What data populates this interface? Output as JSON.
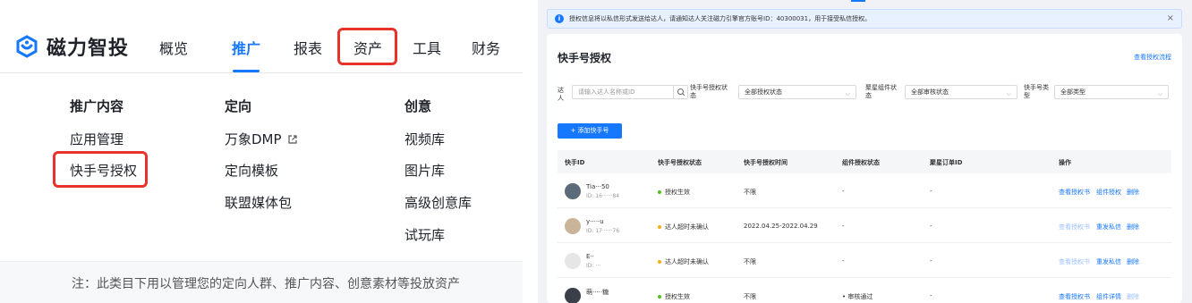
{
  "left": {
    "brand": "磁力智投",
    "nav": [
      "概览",
      "推广",
      "报表",
      "资产",
      "工具",
      "财务"
    ],
    "columns": [
      {
        "title": "推广内容",
        "items": [
          "应用管理",
          "快手号授权"
        ]
      },
      {
        "title": "定向",
        "items": [
          "万象DMP",
          "定向模板",
          "联盟媒体包"
        ]
      },
      {
        "title": "创意",
        "items": [
          "视频库",
          "图片库",
          "高级创意库",
          "试玩库"
        ]
      }
    ],
    "footer_note": "注：此类目下用以管理您的定向人群、推广内容、创意素材等投放资产"
  },
  "right": {
    "notice": "授权信息将以私信形式发送给达人，请通知达人关注磁力引擎官方账号ID：40300031，用于接受私信授权。",
    "close": "×",
    "title": "快手号授权",
    "view_flow": "查看授权流程",
    "filters": {
      "talent_label": "达人",
      "talent_placeholder": "请输入达人名称或ID",
      "auth_status_label": "快手号授权状态",
      "auth_status_value": "全部授权状态",
      "agg_label": "聚星组件状态",
      "agg_value": "全部审核状态",
      "type_label": "快手号类型",
      "type_value": "全部类型"
    },
    "add_button": "+ 添加快手号",
    "columns": [
      "快手ID",
      "快手号授权状态",
      "快手号授权时间",
      "组件授权状态",
      "聚星订单ID",
      "操作"
    ],
    "rows": [
      {
        "name": "Tia···50",
        "id": "ID: 16······84",
        "status": "授权生效",
        "status_color": "#52c41a",
        "time": "不限",
        "component": "-",
        "order": "-",
        "actions": [
          "查看授权书",
          "组件授权",
          "删除"
        ],
        "dim": [
          false,
          false,
          false
        ]
      },
      {
        "name": "y·····u",
        "id": "ID: 17······76",
        "status": "达人超时未确认",
        "status_color": "#faad14",
        "time": "2022.04.25-2022.04.29",
        "component": "-",
        "order": "-",
        "actions": [
          "查看授权书",
          "重发私信",
          "删除"
        ],
        "dim": [
          true,
          false,
          false
        ]
      },
      {
        "name": "E··",
        "id": "ID: ···",
        "status": "达人超时未确认",
        "status_color": "#faad14",
        "time": "不限",
        "component": "-",
        "order": "-",
        "actions": [
          "查看授权书",
          "重发私信",
          "删除"
        ],
        "dim": [
          true,
          false,
          false
        ]
      },
      {
        "name": "萌·····糖",
        "id": "",
        "status": "授权生效",
        "status_color": "#52c41a",
        "time": "不限",
        "component": "• 审核通过",
        "order": "-",
        "actions": [
          "查看授权书",
          "组件详情",
          "删除"
        ],
        "dim": [
          false,
          false,
          true
        ]
      }
    ]
  },
  "colors": {
    "accent": "#1677ff",
    "highlight": "#e8322c"
  }
}
